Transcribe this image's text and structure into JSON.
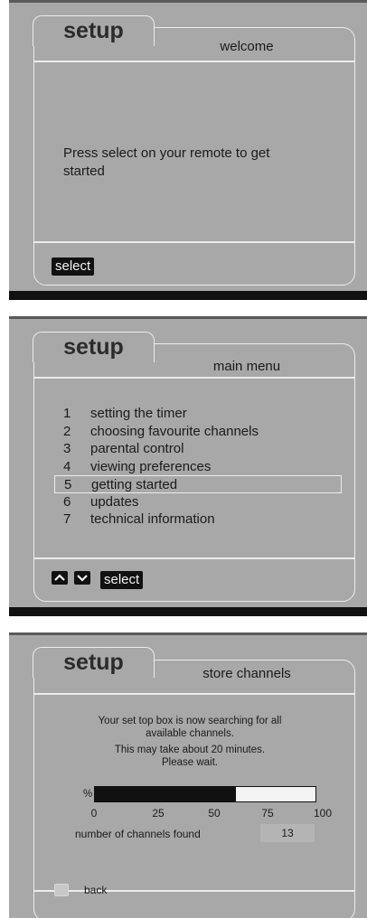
{
  "screens": [
    {
      "tab_title": "setup",
      "header": "welcome",
      "message": "Press select on your remote to get started",
      "select_label": "select"
    },
    {
      "tab_title": "setup",
      "header": "main menu",
      "items": [
        {
          "num": "1",
          "label": "setting the timer"
        },
        {
          "num": "2",
          "label": "choosing favourite channels"
        },
        {
          "num": "3",
          "label": "parental control"
        },
        {
          "num": "4",
          "label": "viewing preferences"
        },
        {
          "num": "5",
          "label": "getting started"
        },
        {
          "num": "6",
          "label": "updates"
        },
        {
          "num": "7",
          "label": "technical information"
        }
      ],
      "selected_index": 4,
      "select_label": "select"
    },
    {
      "tab_title": "setup",
      "header": "store channels",
      "info_lines": [
        "Your set top box is now searching for all",
        "available channels.",
        "This may take about 20 minutes.",
        "Please wait."
      ],
      "percent_symbol": "%",
      "progress_percent": 64,
      "scale_ticks": [
        "0",
        "25",
        "50",
        "75",
        "100"
      ],
      "channels_found_label": "number of channels found",
      "channels_found_count": "13",
      "back_label": "back"
    }
  ]
}
